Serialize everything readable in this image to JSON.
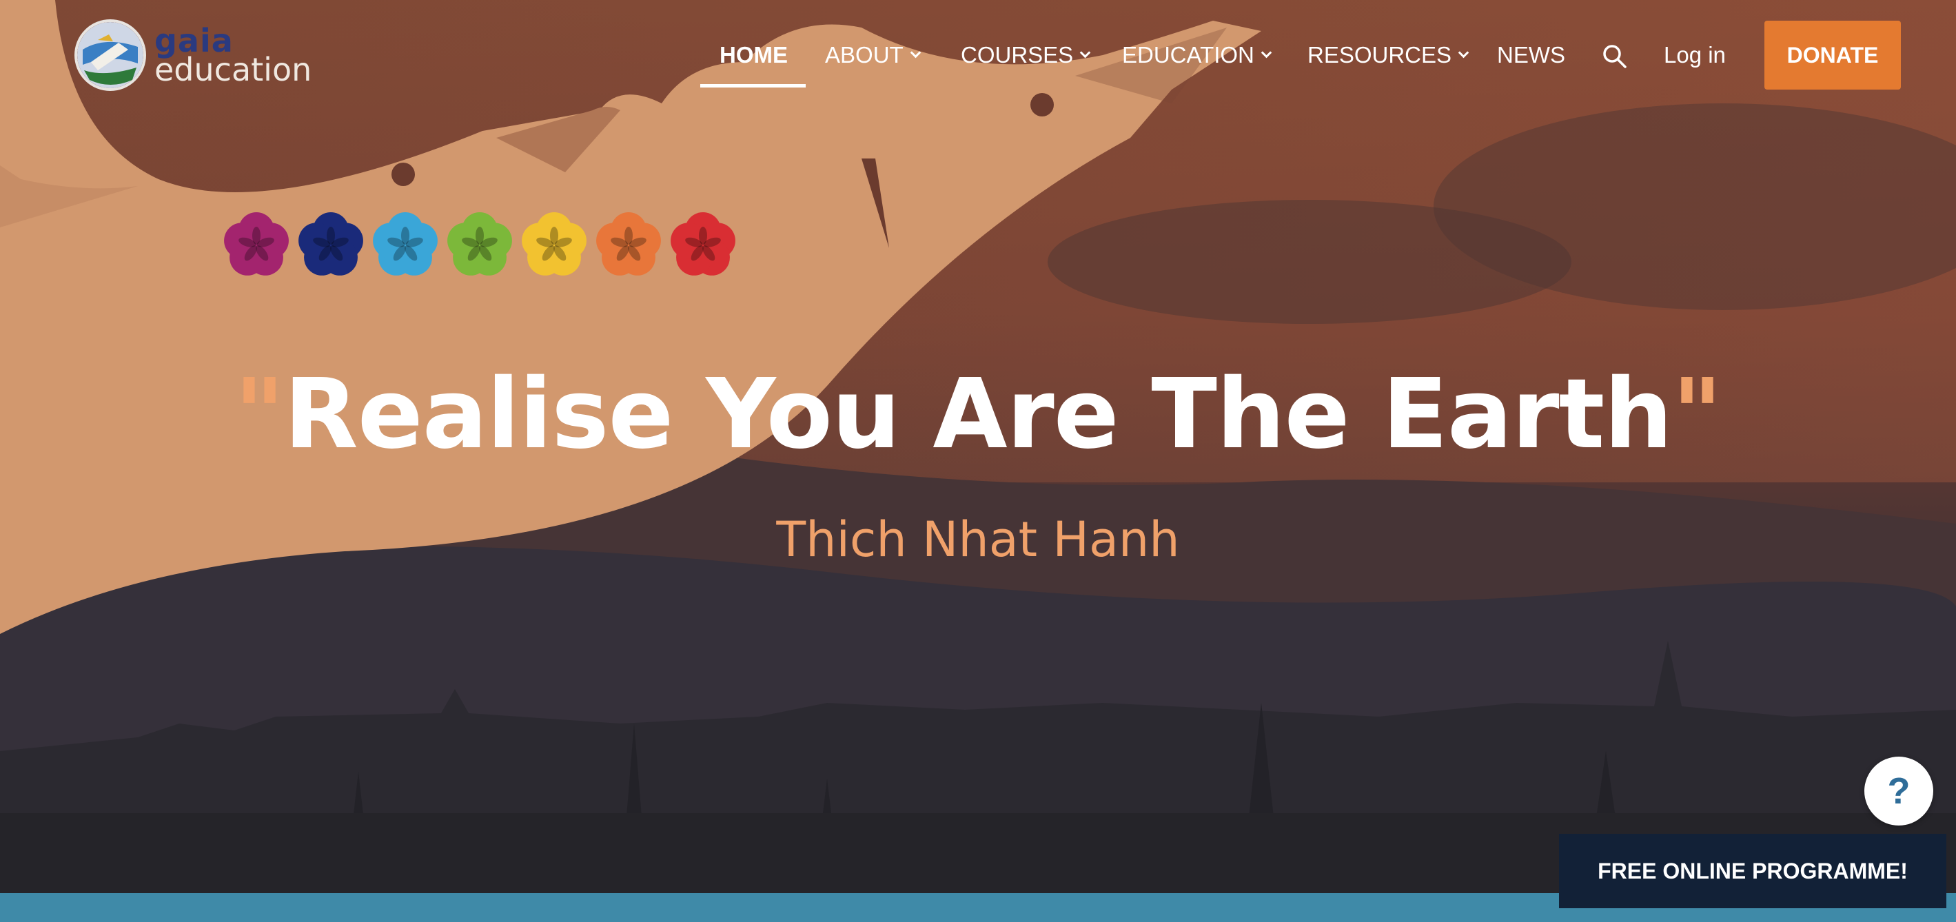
{
  "logo": {
    "line1": "gaia",
    "line2": "education"
  },
  "nav": {
    "items": [
      {
        "label": "HOME",
        "active": true,
        "has_dropdown": false
      },
      {
        "label": "ABOUT",
        "active": false,
        "has_dropdown": true
      },
      {
        "label": "COURSES",
        "active": false,
        "has_dropdown": true
      },
      {
        "label": "EDUCATION",
        "active": false,
        "has_dropdown": true
      },
      {
        "label": "RESOURCES",
        "active": false,
        "has_dropdown": true
      },
      {
        "label": "NEWS",
        "active": false,
        "has_dropdown": false
      }
    ],
    "search_icon": "search-icon",
    "login_label": "Log in",
    "donate_label": "DONATE"
  },
  "hero": {
    "flower_colors": [
      "#a3246e",
      "#1a2a7a",
      "#3aa6d8",
      "#7cb83a",
      "#f2c230",
      "#e8763a",
      "#d92e33"
    ],
    "quote_open": "\"",
    "quote_text": "Realise You Are The Earth",
    "quote_close": "\"",
    "author": "Thich Nhat Hanh"
  },
  "help": {
    "label": "?"
  },
  "banner": {
    "label": "FREE ONLINE PROGRAMME!"
  },
  "colors": {
    "accent": "#e47a30",
    "quote_mark": "#f0a16a",
    "banner_bg": "#122137",
    "strip": "#3f8aa8"
  }
}
